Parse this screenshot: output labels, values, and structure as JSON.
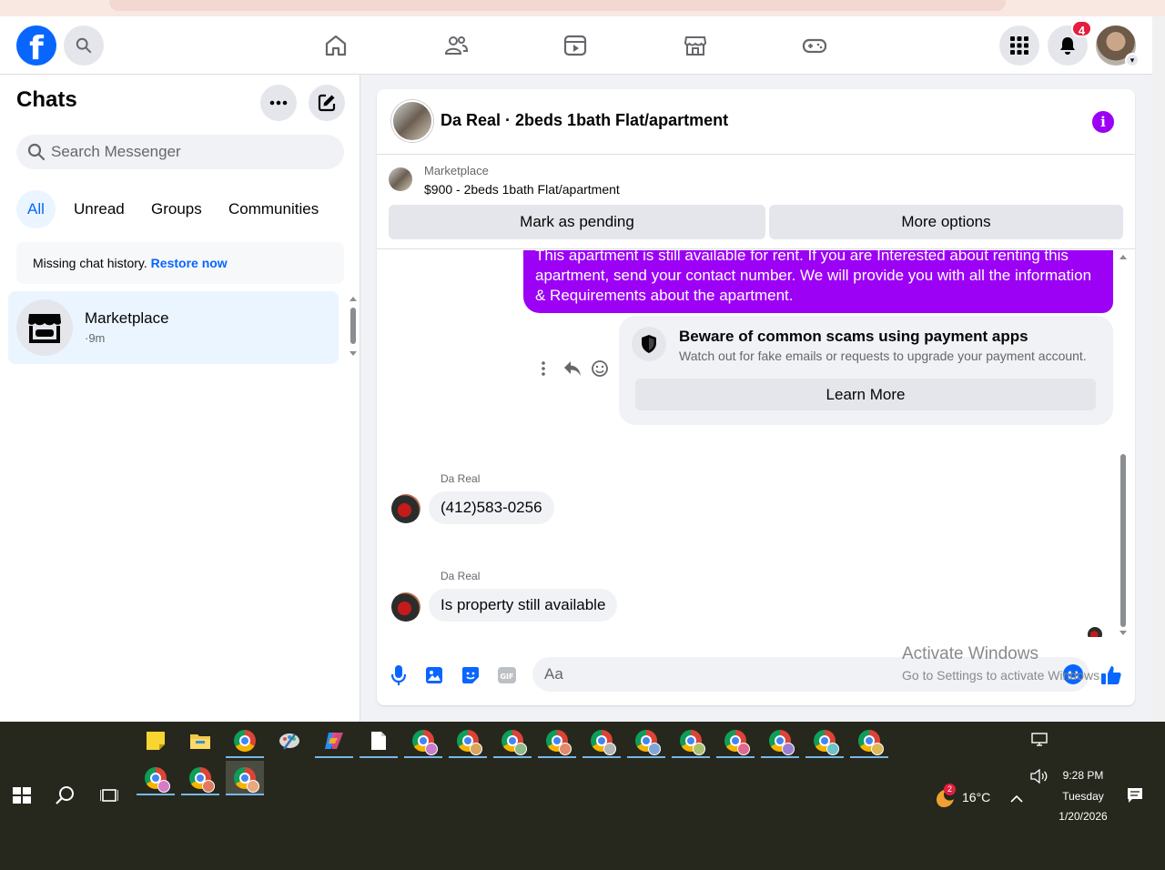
{
  "header": {
    "logo": "f",
    "notifications_count": "4"
  },
  "sidebar": {
    "title": "Chats",
    "search_placeholder": "Search Messenger",
    "filters": [
      {
        "label": "All"
      },
      {
        "label": "Unread"
      },
      {
        "label": "Groups"
      },
      {
        "label": "Communities"
      }
    ],
    "missing_history": {
      "text": "Missing chat history. ",
      "link": "Restore now"
    },
    "chat_item": {
      "name": "Marketplace",
      "time": "·9m"
    }
  },
  "conversation": {
    "title": "Da Real · 2beds 1bath Flat/apartment",
    "banner": {
      "label": "Marketplace",
      "price_text": "$900 - 2beds 1bath Flat/apartment",
      "mark_pending": "Mark as pending",
      "more_options": "More options"
    },
    "sent_message": "This apartment is still available for rent. If you are Interested about renting this apartment, send your contact number. We will provide you with all the information & Requirements about the apartment.",
    "scam_card": {
      "title": "Beware of common scams using payment apps",
      "text": "Watch out for fake emails or requests to upgrade your payment account.",
      "button": "Learn More"
    },
    "received": [
      {
        "sender": "Da Real",
        "text": "(412)583-0256"
      },
      {
        "sender": "Da Real",
        "text": "Is property still available"
      }
    ],
    "composer_placeholder": "Aa"
  },
  "watermark": {
    "line1": "Activate Windows",
    "line2": "Go to Settings to activate Windows."
  },
  "taskbar": {
    "weather_badge": "2",
    "temperature": "16°C",
    "time": "9:28 PM",
    "day": "Tuesday",
    "date": "1/20/2026"
  },
  "colors": {
    "brand": "#0866ff",
    "sent_bubble": "#9c00f5",
    "notification": "#e41e3f"
  }
}
